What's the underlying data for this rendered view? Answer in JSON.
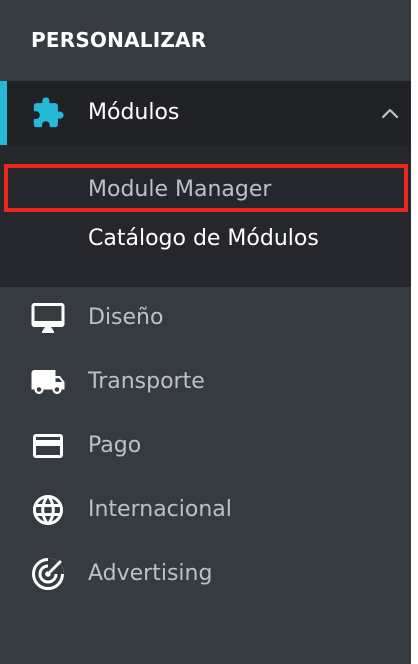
{
  "sidebar": {
    "section_title": "PERSONALIZAR",
    "active_item": {
      "label": "Módulos",
      "icon": "puzzle-icon",
      "expanded": true,
      "children": [
        {
          "label": "Module Manager",
          "selected": true
        },
        {
          "label": "Catálogo de Módulos",
          "selected": false
        }
      ]
    },
    "items": [
      {
        "label": "Diseño",
        "icon": "monitor-icon"
      },
      {
        "label": "Transporte",
        "icon": "truck-icon"
      },
      {
        "label": "Pago",
        "icon": "credit-card-icon"
      },
      {
        "label": "Internacional",
        "icon": "globe-icon"
      },
      {
        "label": "Advertising",
        "icon": "radar-icon"
      }
    ]
  },
  "colors": {
    "sidebar_bg": "#363a41",
    "active_bg": "#202226",
    "submenu_bg": "#25272c",
    "accent": "#25b9d7",
    "text_primary": "#ffffff",
    "text_muted": "#bcc1c8",
    "highlight_border": "#e7281f"
  }
}
